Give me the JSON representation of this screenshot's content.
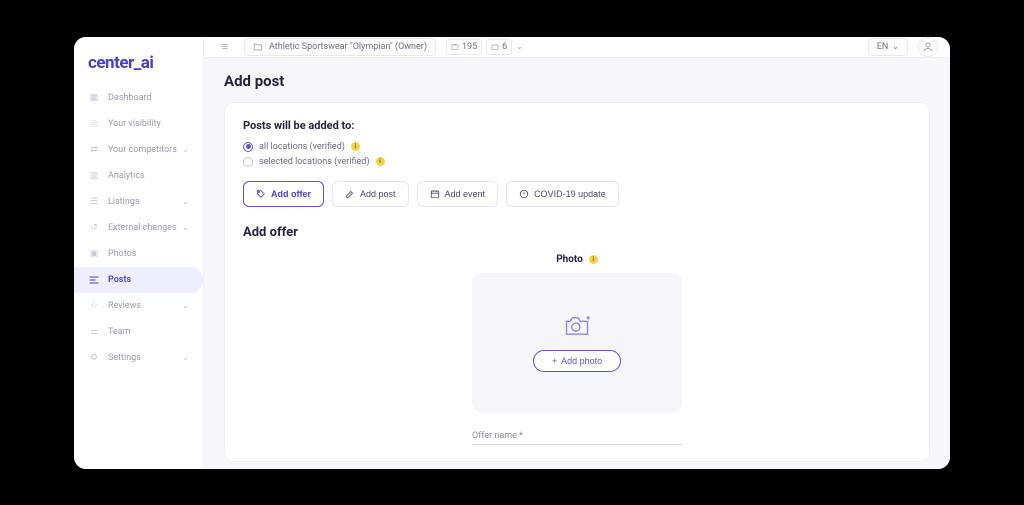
{
  "logo": "center_ai",
  "nav": {
    "items": [
      {
        "label": "Dashboard",
        "icon": "grid"
      },
      {
        "label": "Your visibility",
        "icon": "eye"
      },
      {
        "label": "Your competitors",
        "icon": "compare",
        "expandable": true
      },
      {
        "label": "Analytics",
        "icon": "bars"
      },
      {
        "label": "Listings",
        "icon": "list",
        "expandable": true
      },
      {
        "label": "External changes",
        "icon": "swap",
        "expandable": true
      },
      {
        "label": "Photos",
        "icon": "image"
      },
      {
        "label": "Posts",
        "icon": "posts",
        "active": true
      },
      {
        "label": "Reviews",
        "icon": "star",
        "expandable": true
      },
      {
        "label": "Team",
        "icon": "team"
      },
      {
        "label": "Settings",
        "icon": "gear",
        "expandable": true
      }
    ]
  },
  "topbar": {
    "folder_label": "Athletic Sportswear \"Olympian\" (Owner)",
    "stat1": "195",
    "stat2": "6",
    "lang": "EN"
  },
  "page": {
    "title": "Add post",
    "scope_title": "Posts will be added to:",
    "radio_all": "all locations (verified)",
    "radio_selected": "selected locations (verified)",
    "tabs": {
      "add_offer": "Add offer",
      "add_post": "Add post",
      "add_event": "Add event",
      "covid": "COVID-19 update"
    },
    "section_title": "Add offer",
    "photo_label": "Photo",
    "add_photo_btn": "Add photo",
    "offer_name_label": "Offer name *"
  }
}
